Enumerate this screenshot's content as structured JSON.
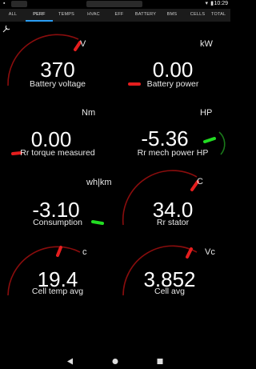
{
  "statusbar": {
    "time": "10:29"
  },
  "tabs": [
    {
      "label": "ALL",
      "active": false
    },
    {
      "label": "PERF",
      "active": true
    },
    {
      "label": "TEMPS",
      "active": false
    },
    {
      "label": "HVAC",
      "active": false
    },
    {
      "label": "EFF",
      "active": false
    },
    {
      "label": "BATTERY",
      "active": false
    },
    {
      "label": "BMS",
      "active": false
    },
    {
      "label": "CELLS",
      "active": false
    },
    {
      "label": "TOTAL",
      "active": false
    }
  ],
  "gauges": [
    {
      "unit": "V",
      "value": "370",
      "label": "Battery voltage",
      "arc": true,
      "needle_color": "#e51e1e"
    },
    {
      "unit": "kW",
      "value": "0.00",
      "label": "Battery power",
      "arc": false,
      "needle_color": "#e51e1e"
    },
    {
      "unit": "Nm",
      "value": "0.00",
      "label": "Rr torque measured",
      "arc": false,
      "needle_color": "#e51e1e"
    },
    {
      "unit": "HP",
      "value": "-5.36",
      "label": "Rr mech power HP",
      "arc": true,
      "needle_color": "#22dd22"
    },
    {
      "unit": "wh|km",
      "value": "-3.10",
      "label": "Consumption",
      "arc": false,
      "needle_color": "#22dd22"
    },
    {
      "unit": "C",
      "value": "34.0",
      "label": "Rr stator",
      "arc": true,
      "needle_color": "#e51e1e"
    },
    {
      "unit": "c",
      "value": "19.4",
      "label": "Cell temp avg",
      "arc": true,
      "needle_color": "#e51e1e"
    },
    {
      "unit": "Vc",
      "value": "3.852",
      "label": "Cell avg",
      "arc": true,
      "needle_color": "#e51e1e"
    }
  ],
  "colors": {
    "arc": "#8a0d0d",
    "tab_indicator": "#2a9df4"
  },
  "icons": [
    "wrench-icon",
    "back-icon",
    "home-icon",
    "recents-icon"
  ]
}
